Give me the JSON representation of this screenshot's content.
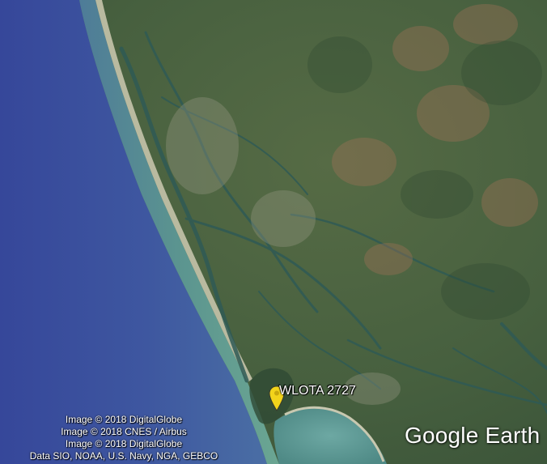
{
  "placemark": {
    "label": "WLOTA 2727",
    "pin_color": "#f2d31b"
  },
  "attribution": [
    "Image © 2018 DigitalGlobe",
    "Image © 2018 CNES / Airbus",
    "Image © 2018 DigitalGlobe",
    "Data SIO, NOAA, U.S. Navy, NGA, GEBCO"
  ],
  "logo": {
    "text": "Google Earth"
  },
  "colors": {
    "ocean_deep": "#3a4a98",
    "ocean_shallow": "#5f9c96",
    "beach": "#b7b89b",
    "vegetation": "#3f5a3a",
    "water_channels": "#2f5a52"
  }
}
